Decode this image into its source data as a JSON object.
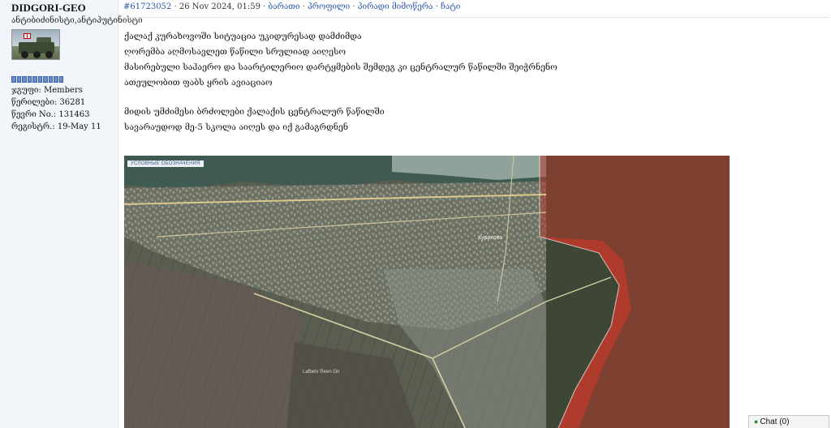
{
  "profile": {
    "username": "DIDGORI-GEO",
    "user_title": "ანტიბიძინისტი,ანტიპუტინისტი",
    "stats": [
      "ჯგუფი: Members",
      "წერილები: 36281",
      "წევრი No.: 131463",
      "რეგისტრ.: 19-May 11"
    ]
  },
  "post_header": {
    "post_id": "#61723052",
    "sep1": " · ",
    "date": "26 Nov 2024, 01:59",
    "sep2": " · ",
    "link_report": "ბარათი",
    "sep3": " · ",
    "link_profile": "პროფილი",
    "sep4": " · ",
    "link_pm": "პირადი მიმოწერა",
    "sep5": " · ",
    "link_chat": "ჩატი"
  },
  "post_body": {
    "lines_a": [
      "ქალაქ კურახოვოში სიტუაცია უკიდურესად დამძიმდა",
      "ღორემბა აღმოსავლეთ წაწილი სრულიად აიღესო",
      "მასირებული საჰაერო და საარტილერიო დარტყმების შემდეგ კი ცენტრალურ წაწილში შეიჭრნენო",
      "ათეულობით ფაბს ყრის ავიაციაო"
    ],
    "lines_b": [
      "მიდის უმძიმესი ბრძოლები ქალაქის ცენტრალურ წაწილში",
      "სავარაუდოდ მე-5 სკოლა აიღეს და იქ გამაგრდნენ"
    ]
  },
  "map": {
    "legend_label": "УСЛОВНЫЕ ОБОЗНАЧЕНИЯ",
    "place_label": "Курахово",
    "field_label": "Lafbetv Reen Gir"
  },
  "chat": {
    "label": "Chat",
    "count": "(0)"
  },
  "colors": {
    "link": "#2b56a8",
    "profile_bg": "#f2f6fa",
    "occupied_zone": "#c0392b"
  }
}
